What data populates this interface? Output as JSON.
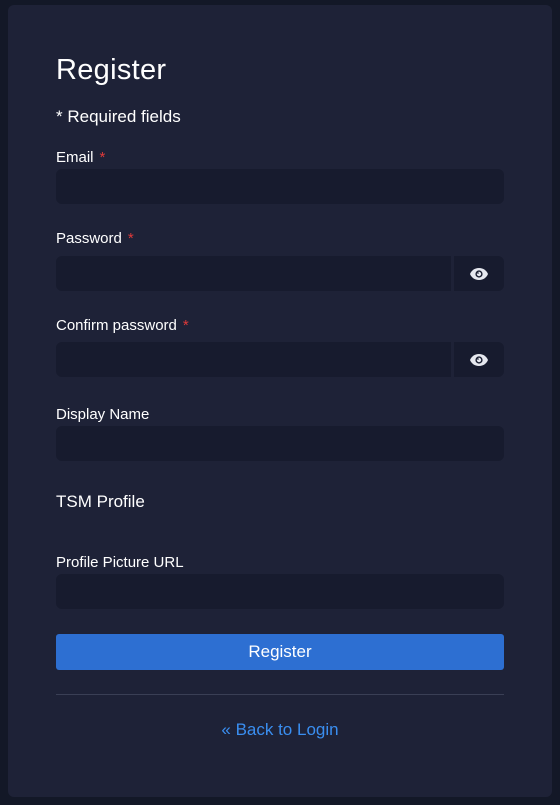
{
  "form": {
    "title": "Register",
    "required_note": "* Required fields",
    "required_marker": "*"
  },
  "fields": {
    "email": {
      "label": "Email",
      "value": "",
      "placeholder": ""
    },
    "password": {
      "label": "Password",
      "value": "",
      "placeholder": ""
    },
    "confirm_password": {
      "label": "Confirm password",
      "value": "",
      "placeholder": ""
    },
    "display_name": {
      "label": "Display Name",
      "value": "",
      "placeholder": ""
    },
    "profile_picture_url": {
      "label": "Profile Picture URL",
      "value": "",
      "placeholder": ""
    }
  },
  "sections": {
    "tsm_profile": "TSM Profile"
  },
  "actions": {
    "register_label": "Register",
    "back_to_login_label": "« Back to Login"
  },
  "icons": {
    "password_toggle": "eye-icon"
  },
  "colors": {
    "background": "#131827",
    "card": "#1e2237",
    "input": "#171b2e",
    "primary_button": "#2d6fd2",
    "link": "#3a8ef0",
    "required_star": "#e03a3a"
  }
}
